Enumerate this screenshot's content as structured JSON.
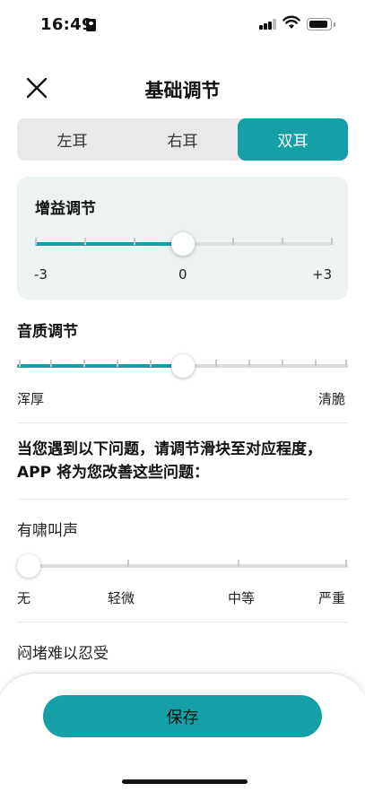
{
  "status_bar": {
    "time": "16:49"
  },
  "header": {
    "title": "基础调节",
    "close_icon": "close-icon"
  },
  "segmented": {
    "options": [
      "左耳",
      "右耳",
      "双耳"
    ],
    "selected": "双耳"
  },
  "gain": {
    "title": "增益调节",
    "min_label": "-3",
    "mid_label": "0",
    "max_label": "+3",
    "min": -3,
    "max": 3,
    "value": 0
  },
  "tone": {
    "title": "音质调节",
    "left_label": "浑厚",
    "right_label": "清脆",
    "value_fraction": 0.5
  },
  "instruction": "当您遇到以下问题，请调节滑块至对应程度，APP 将为您改善这些问题：",
  "issues": [
    {
      "title": "有啸叫声",
      "levels": [
        "无",
        "轻微",
        "中等",
        "严重"
      ],
      "value_fraction": 0
    },
    {
      "title": "闷堵难以忍受"
    }
  ],
  "save_label": "保存",
  "colors": {
    "accent": "#14a0a6",
    "track": "#dcdcdc",
    "card_bg": "#edf2f2"
  }
}
